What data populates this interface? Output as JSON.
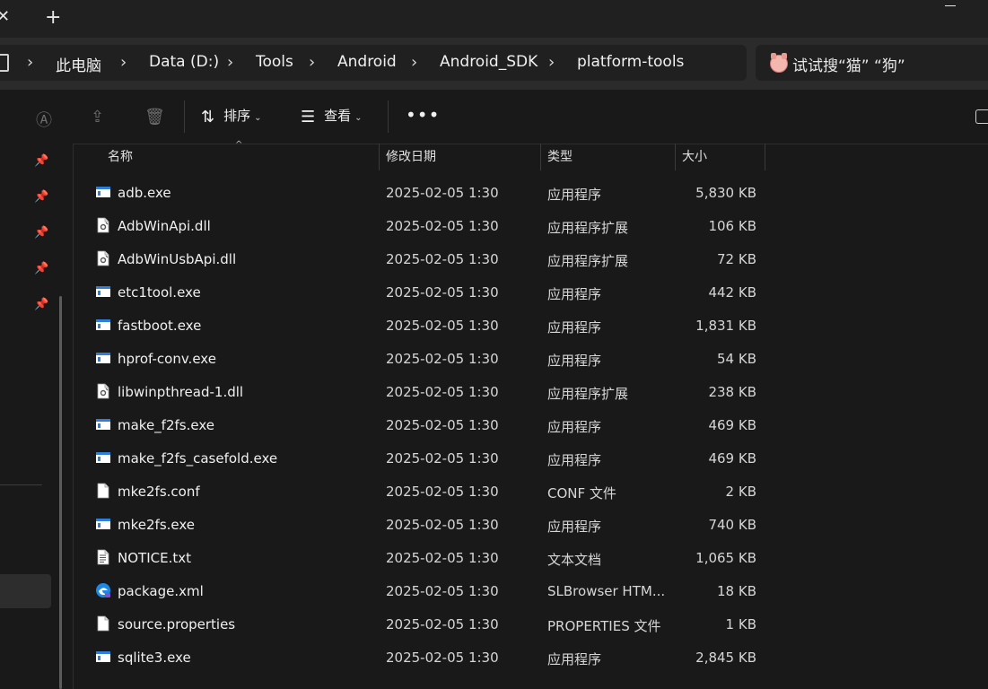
{
  "window": {
    "tab_close_glyph": "✕",
    "new_tab_glyph": "+"
  },
  "address": {
    "crumbs": [
      "此电脑",
      "Data (D:)",
      "Tools",
      "Android",
      "Android_SDK",
      "platform-tools"
    ],
    "separator": "›"
  },
  "search": {
    "text": "试试搜“猫” “狗”"
  },
  "toolbar": {
    "sort_label": "排序",
    "view_label": "查看",
    "more_glyph": "•••"
  },
  "columns": {
    "name": "名称",
    "date": "修改日期",
    "type": "类型",
    "size": "大小"
  },
  "files": [
    {
      "name": "adb.exe",
      "date": "2025-02-05 1:30",
      "type": "应用程序",
      "size": "5,830 KB",
      "icon": "exe"
    },
    {
      "name": "AdbWinApi.dll",
      "date": "2025-02-05 1:30",
      "type": "应用程序扩展",
      "size": "106 KB",
      "icon": "dll"
    },
    {
      "name": "AdbWinUsbApi.dll",
      "date": "2025-02-05 1:30",
      "type": "应用程序扩展",
      "size": "72 KB",
      "icon": "dll"
    },
    {
      "name": "etc1tool.exe",
      "date": "2025-02-05 1:30",
      "type": "应用程序",
      "size": "442 KB",
      "icon": "exe"
    },
    {
      "name": "fastboot.exe",
      "date": "2025-02-05 1:30",
      "type": "应用程序",
      "size": "1,831 KB",
      "icon": "exe"
    },
    {
      "name": "hprof-conv.exe",
      "date": "2025-02-05 1:30",
      "type": "应用程序",
      "size": "54 KB",
      "icon": "exe"
    },
    {
      "name": "libwinpthread-1.dll",
      "date": "2025-02-05 1:30",
      "type": "应用程序扩展",
      "size": "238 KB",
      "icon": "dll"
    },
    {
      "name": "make_f2fs.exe",
      "date": "2025-02-05 1:30",
      "type": "应用程序",
      "size": "469 KB",
      "icon": "exe"
    },
    {
      "name": "make_f2fs_casefold.exe",
      "date": "2025-02-05 1:30",
      "type": "应用程序",
      "size": "469 KB",
      "icon": "exe"
    },
    {
      "name": "mke2fs.conf",
      "date": "2025-02-05 1:30",
      "type": "CONF 文件",
      "size": "2 KB",
      "icon": "file"
    },
    {
      "name": "mke2fs.exe",
      "date": "2025-02-05 1:30",
      "type": "应用程序",
      "size": "740 KB",
      "icon": "exe"
    },
    {
      "name": "NOTICE.txt",
      "date": "2025-02-05 1:30",
      "type": "文本文档",
      "size": "1,065 KB",
      "icon": "txt"
    },
    {
      "name": "package.xml",
      "date": "2025-02-05 1:30",
      "type": "SLBrowser HTM...",
      "size": "18 KB",
      "icon": "browser"
    },
    {
      "name": "source.properties",
      "date": "2025-02-05 1:30",
      "type": "PROPERTIES 文件",
      "size": "1 KB",
      "icon": "file"
    },
    {
      "name": "sqlite3.exe",
      "date": "2025-02-05 1:30",
      "type": "应用程序",
      "size": "2,845 KB",
      "icon": "exe"
    }
  ],
  "colors": {
    "background": "#191919",
    "chrome": "#2b2b2b",
    "text": "#f0f0f0",
    "exe_icon_blue": "#2f7fd8"
  }
}
